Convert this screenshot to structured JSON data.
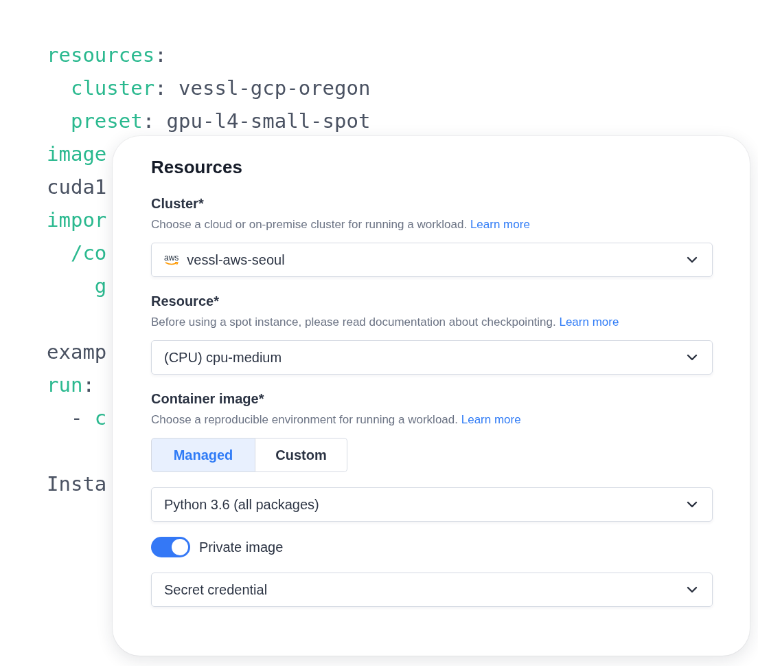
{
  "code_blocks": [
    {
      "lines": [
        [
          {
            "text": "resources",
            "kind": "key"
          },
          {
            "text": ":",
            "kind": "plain"
          }
        ],
        [
          {
            "text": "  cluster",
            "kind": "key"
          },
          {
            "text": ": vessl-gcp-oregon",
            "kind": "plain"
          }
        ],
        [
          {
            "text": "  preset",
            "kind": "key"
          },
          {
            "text": ": gpu-l4-small-spot",
            "kind": "plain"
          }
        ],
        [
          {
            "text": "image",
            "kind": "key"
          }
        ],
        [
          {
            "text": "cuda1",
            "kind": "plain"
          }
        ],
        [
          {
            "text": "impor",
            "kind": "key"
          }
        ],
        [
          {
            "text": "  /co",
            "kind": "key"
          }
        ],
        [
          {
            "text": "    g",
            "kind": "key"
          }
        ]
      ]
    },
    {
      "lines": [
        [
          {
            "text": "examp",
            "kind": "plain"
          }
        ],
        [
          {
            "text": "run",
            "kind": "key"
          },
          {
            "text": ":",
            "kind": "plain"
          }
        ],
        [
          {
            "text": "  - ",
            "kind": "plain"
          },
          {
            "text": "c",
            "kind": "key"
          }
        ]
      ]
    },
    {
      "lines": [
        [
          {
            "text": "Insta",
            "kind": "plain"
          }
        ]
      ]
    }
  ],
  "panel": {
    "title": "Resources",
    "fields": [
      {
        "label": "Cluster*",
        "description": "Choose a cloud or on-premise cluster for running a workload.",
        "link": "Learn more",
        "controls": [
          {
            "kind": "select",
            "logo": "aws",
            "value": "vessl-aws-seoul"
          }
        ]
      },
      {
        "label": "Resource*",
        "description": "Before using a spot instance, please read documentation about checkpointing.",
        "link": "Learn more",
        "controls": [
          {
            "kind": "select",
            "value": "(CPU) cpu-medium"
          }
        ]
      },
      {
        "label": "Container image*",
        "description": "Choose a reproducible environment for running a workload.",
        "link": "Learn more",
        "controls": [
          {
            "kind": "segmented",
            "options": [
              {
                "label": "Managed",
                "selected": true
              },
              {
                "label": "Custom",
                "selected": false
              }
            ]
          },
          {
            "kind": "select",
            "value": "Python 3.6 (all packages)"
          },
          {
            "kind": "toggle",
            "label": "Private image",
            "on": true
          },
          {
            "kind": "select",
            "value": "Secret credential"
          }
        ]
      }
    ]
  }
}
